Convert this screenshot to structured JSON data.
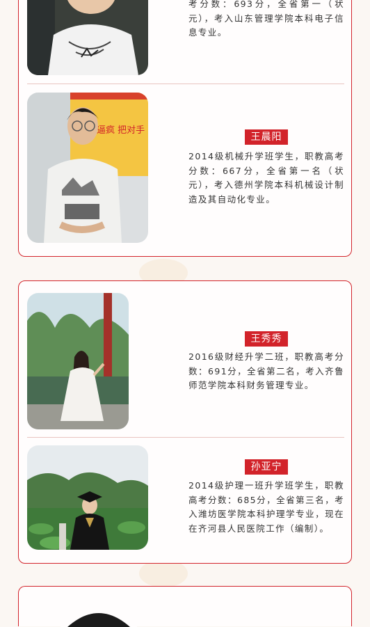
{
  "students": [
    {
      "name": "",
      "desc": "考分数：693分，全省第一（状元），考入山东管理学院本科电子信息专业。"
    },
    {
      "name": "王晨阳",
      "desc": "2014级机械升学班学生，职教高考分数：667分，全省第一名（状元），考入德州学院本科机械设计制造及其自动化专业。"
    },
    {
      "name": "王秀秀",
      "desc": "2016级财经升学二班，职教高考分数：691分，全省第二名，考入齐鲁师范学院本科财务管理专业。"
    },
    {
      "name": "孙亚宁",
      "desc": "2014级护理一班升学班学生，职教高考分数：685分，全省第三名，考入潍坊医学院本科护理学专业，现在在齐河县人民医院工作（编制）。"
    }
  ],
  "photo_sign_text": "逼疯 把对手",
  "colors": {
    "accent": "#d2232a",
    "divider": "#e9c4c0",
    "text": "#333333"
  }
}
